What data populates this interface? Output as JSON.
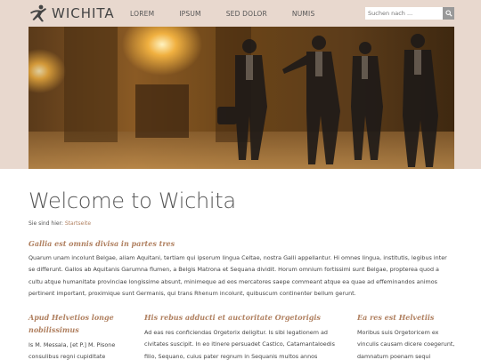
{
  "header": {
    "logo_text": "WICHITA",
    "nav": [
      "LOREM",
      "IPSUM",
      "SED DOLOR",
      "NUMIS"
    ],
    "search_placeholder": "Suchen nach ..."
  },
  "colors": {
    "band": "#e8d8ce",
    "accent": "#b08060"
  },
  "page": {
    "title": "Welcome to Wichita",
    "breadcrumb_prefix": "Sie sind hier:",
    "breadcrumb_link": "Startseite"
  },
  "intro": {
    "heading": "Gallia est omnis divisa in partes tres",
    "text": "Quarum unam incolunt Belgae, aliam Aquitani, tertiam qui ipsorum lingua Celtae, nostra Galli appellantur. Hi omnes lingua, institutis, legibus inter se differunt. Gallos ab Aquitanis Garumna flumen, a Belgis Matrona et Sequana dividit. Horum omnium fortissimi sunt Belgae, propterea quod a cultu atque humanitate provinciae longissime absunt, minimeque ad eos mercatores saepe commeant atque ea quae ad effeminandos animos pertinent important, proximique sunt Germanis, qui trans Rhenum incolunt, quibuscum continenter bellum gerunt."
  },
  "columns": [
    {
      "heading": "Apud Helvetios longe nobilissimus",
      "text": "Is M. Messala, [et P.] M. Pisone consulibus regni cupiditate"
    },
    {
      "heading": "His rebus adducti et auctoritate Orgetorigis",
      "text": "Ad eas res conficiendas Orgetorix deligitur. Is sibi legationem ad civitates suscipit. In eo itinere persuadet Castico, Catamantaloedis filio, Sequano, cuius pater regnum in Sequanis multos annos obtinuerat et a"
    },
    {
      "heading": "Ea res est Helvetiis",
      "text": "Moribus suis Orgetoricem ex vinculis causam dicere coegerunt, damnatum poenam sequi"
    }
  ],
  "icons": {
    "logo": "running-man-icon",
    "search": "search-icon"
  }
}
